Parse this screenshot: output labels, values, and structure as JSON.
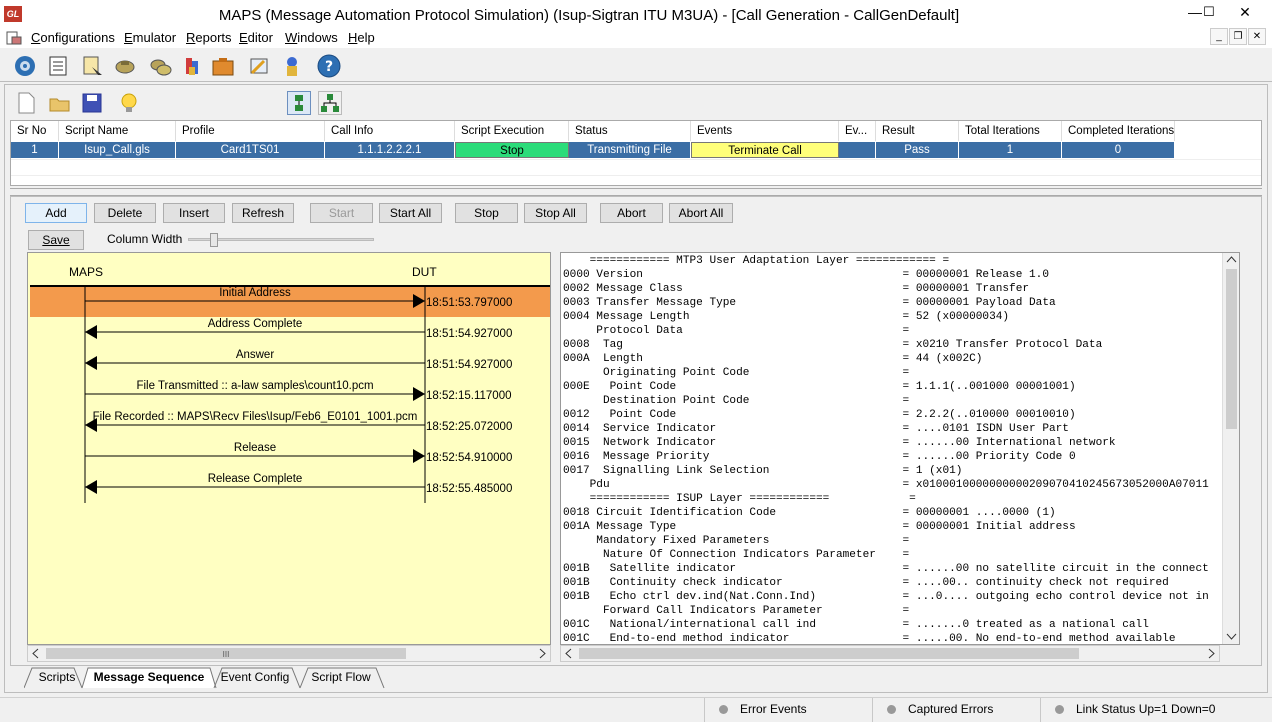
{
  "window": {
    "title": "MAPS (Message Automation Protocol Simulation)  (Isup-Sigtran ITU M3UA) - [Call Generation - CallGenDefault]",
    "app_icon": "GL",
    "minimize": "—",
    "maximize": "☐",
    "close": "✕"
  },
  "menu": {
    "items": [
      {
        "pre": "",
        "u": "C",
        "post": "onfigurations"
      },
      {
        "pre": "",
        "u": "E",
        "post": "mulator"
      },
      {
        "pre": "",
        "u": "R",
        "post": "eports"
      },
      {
        "pre": "",
        "u": "E",
        "post": "ditor"
      },
      {
        "pre": "",
        "u": "W",
        "post": "indows"
      },
      {
        "pre": "",
        "u": "H",
        "post": "elp"
      }
    ],
    "mdi_min": "_",
    "mdi_restore": "❐",
    "mdi_close": "✕"
  },
  "grid": {
    "headers": [
      "Sr No",
      "Script Name",
      "Profile",
      "Call Info",
      "Script Execution",
      "Status",
      "Events",
      "Ev...",
      "Result",
      "Total Iterations",
      "Completed Iterations"
    ],
    "row": [
      "1",
      "Isup_Call.gls",
      "Card1TS01",
      "1.1.1.2.2.2.1",
      "Stop",
      "Transmitting File",
      "Terminate Call",
      "",
      "Pass",
      "1",
      "0"
    ]
  },
  "buttons": {
    "add": "Add",
    "delete": "Delete",
    "insert": "Insert",
    "refresh": "Refresh",
    "start": "Start",
    "start_all": "Start All",
    "stop": "Stop",
    "stop_all": "Stop All",
    "abort": "Abort",
    "abort_all": "Abort All",
    "save": "Save"
  },
  "column_width_label": "Column Width",
  "sequence": {
    "left_label": "MAPS",
    "right_label": "DUT",
    "messages": [
      {
        "label": "Initial Address",
        "time": "18:51:53.797000",
        "dir": "right",
        "selected": true
      },
      {
        "label": "Address Complete",
        "time": "18:51:54.927000",
        "dir": "left",
        "selected": false
      },
      {
        "label": "Answer",
        "time": "18:51:54.927000",
        "dir": "left",
        "selected": false
      },
      {
        "label": "File Transmitted :: a-law samples\\count10.pcm",
        "time": "18:52:15.117000",
        "dir": "right",
        "selected": false
      },
      {
        "label": "File Recorded :: MAPS\\Recv Files\\Isup/Feb6_E0101_1001.pcm",
        "time": "18:52:25.072000",
        "dir": "left",
        "selected": false
      },
      {
        "label": "Release",
        "time": "18:52:54.910000",
        "dir": "right",
        "selected": false
      },
      {
        "label": "Release Complete",
        "time": "18:52:55.485000",
        "dir": "left",
        "selected": false
      }
    ]
  },
  "decode_lines": [
    "    ============ MTP3 User Adaptation Layer ============ =",
    "0000 Version                                       = 00000001 Release 1.0",
    "0002 Message Class                                 = 00000001 Transfer",
    "0003 Transfer Message Type                         = 00000001 Payload Data",
    "0004 Message Length                                = 52 (x00000034)",
    "     Protocol Data                                 =",
    "0008  Tag                                          = x0210 Transfer Protocol Data",
    "000A  Length                                       = 44 (x002C)",
    "      Originating Point Code                       =",
    "000E   Point Code                                  = 1.1.1(..001000 00001001)",
    "      Destination Point Code                       =",
    "0012   Point Code                                  = 2.2.2(..010000 00010010)",
    "0014  Service Indicator                            = ....0101 ISDN User Part",
    "0015  Network Indicator                            = ......00 International network",
    "0016  Message Priority                             = ......00 Priority Code 0",
    "0017  Signalling Link Selection                    = 1 (x01)",
    "    Pdu                                            = x0100010000000000209070410245673052000A07011",
    "    ============ ISUP Layer ============            =",
    "0018 Circuit Identification Code                   = 00000001 ....0000 (1)",
    "001A Message Type                                  = 00000001 Initial address",
    "     Mandatory Fixed Parameters                    =",
    "      Nature Of Connection Indicators Parameter    =",
    "001B   Satellite indicator                         = ......00 no satellite circuit in the connect",
    "001B   Continuity check indicator                  = ....00.. continuity check not required",
    "001B   Echo ctrl dev.ind(Nat.Conn.Ind)             = ...0.... outgoing echo control device not in",
    "      Forward Call Indicators Parameter            =",
    "001C   National/international call ind             = .......0 treated as a national call",
    "001C   End-to-end method indicator                 = .....00. No end-to-end method available"
  ],
  "tabs": [
    "Scripts",
    "Message Sequence",
    "Event Config",
    "Script Flow"
  ],
  "status": {
    "error_events": "Error Events",
    "captured_errors": "Captured Errors",
    "link_status": "Link Status Up=1 Down=0"
  },
  "colors": {
    "selected_row": "#3b6ea5",
    "stop_cell": "#2bdc7a",
    "terminate_cell": "#ffff7a",
    "seq_bg": "#ffffc2",
    "seq_selected": "#f39a4c"
  }
}
